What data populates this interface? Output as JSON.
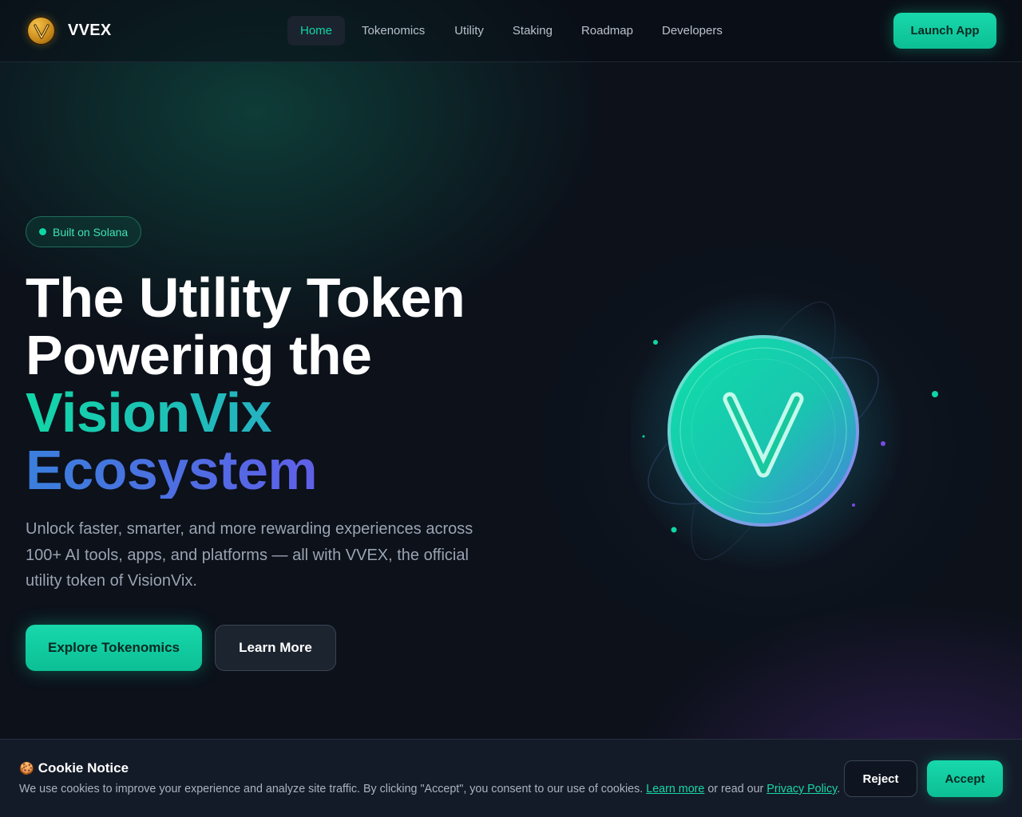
{
  "nav": {
    "brand": "VVEX",
    "logo_icon": "vvex-gold-coin-icon",
    "items": [
      {
        "label": "Home",
        "active": true
      },
      {
        "label": "Tokenomics",
        "active": false
      },
      {
        "label": "Utility",
        "active": false
      },
      {
        "label": "Staking",
        "active": false
      },
      {
        "label": "Roadmap",
        "active": false
      },
      {
        "label": "Developers",
        "active": false
      }
    ],
    "cta": "Launch App"
  },
  "hero": {
    "badge": "Built on Solana",
    "title_lines": [
      "The Utility Token",
      "Powering the",
      "VisionVix",
      "Ecosystem"
    ],
    "description": "Unlock faster, smarter, and more rewarding experiences across 100+ AI tools, apps, and platforms — all with VVEX, the official utility token of VisionVix.",
    "primary_button": "Explore Tokenomics",
    "secondary_button": "Learn More",
    "art_icon": "vvex-token-coin-icon"
  },
  "cookie": {
    "icon": "🍪",
    "title": "Cookie Notice",
    "text_before": "We use cookies to improve your experience and analyze site traffic. By clicking \"Accept\", you consent to our use of cookies.",
    "learn_more": "Learn more",
    "text_middle": "or read our",
    "privacy_link": "Privacy Policy",
    "text_end": ".",
    "reject": "Reject",
    "accept": "Accept"
  },
  "colors": {
    "accent": "#10d6a6",
    "background": "#0c111a",
    "purple": "#7a4ae6"
  }
}
